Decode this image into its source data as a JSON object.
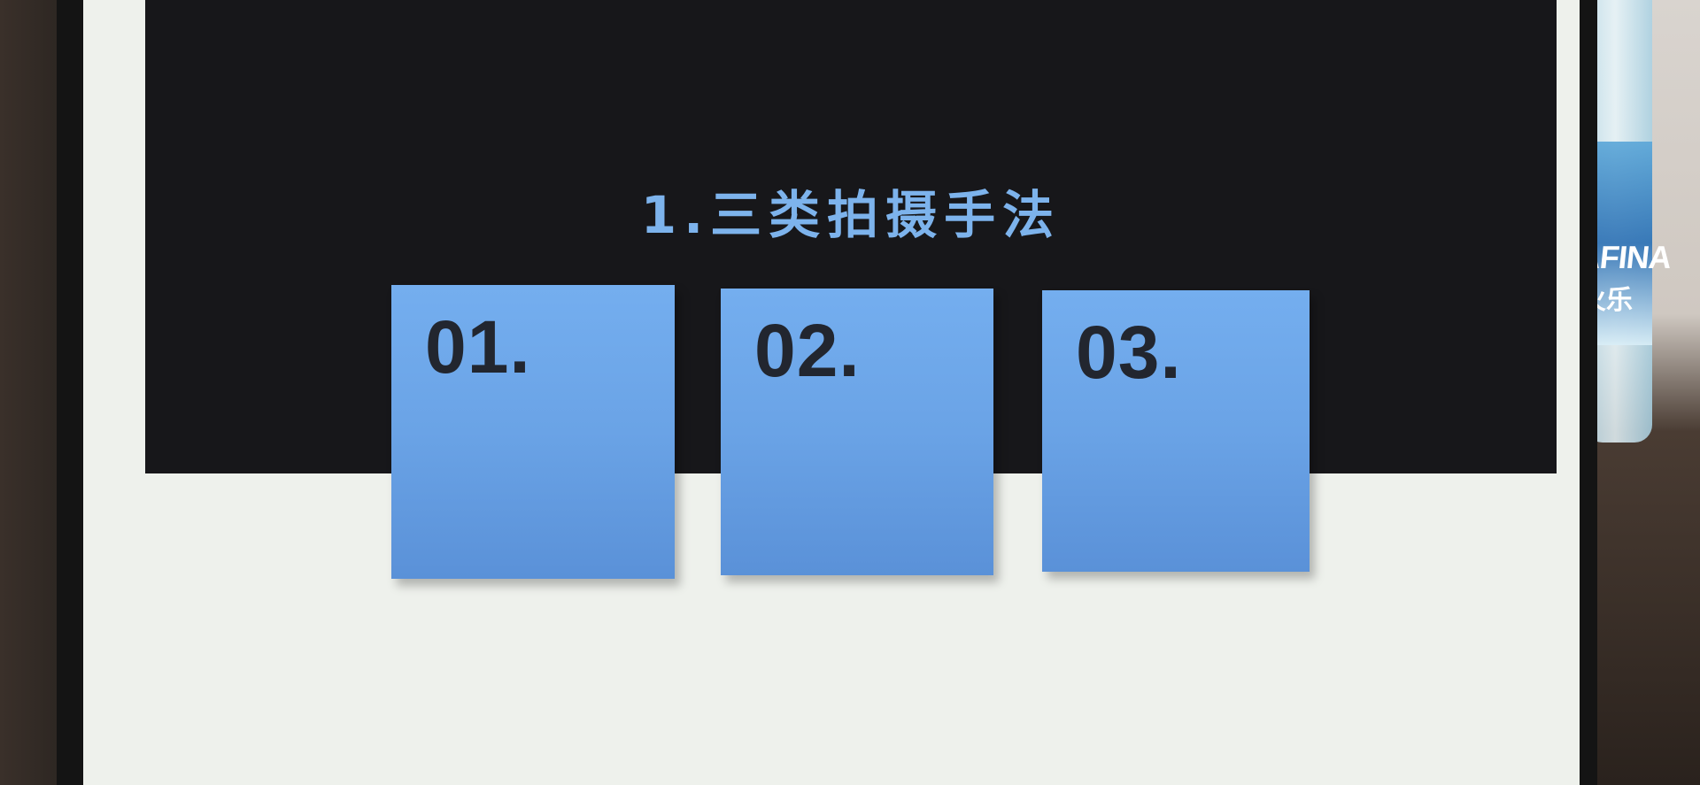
{
  "slide": {
    "title": "1.三类拍摄手法",
    "cards": [
      {
        "label": "01."
      },
      {
        "label": "02."
      },
      {
        "label": "03."
      }
    ]
  },
  "background": {
    "bottle_brand": "AFINA",
    "bottle_sub": "火乐"
  },
  "colors": {
    "title": "#7db3ec",
    "card": "#6aa3e6",
    "dark_band": "#17171a",
    "screen": "#eef1ec"
  }
}
